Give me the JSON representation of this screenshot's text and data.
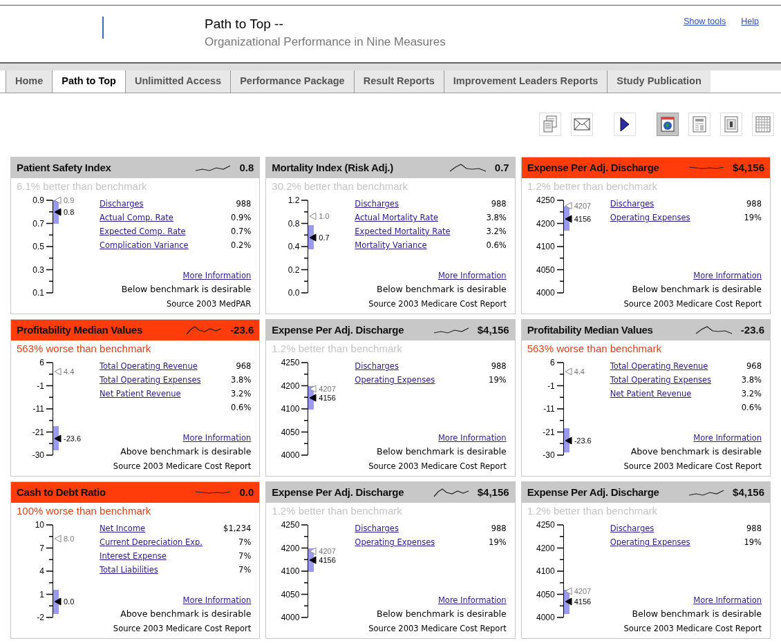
{
  "header": {
    "title": "Path to Top --",
    "subtitle": "Organizational Performance in Nine Measures",
    "links": [
      "Show tools",
      "Help"
    ]
  },
  "tabs": [
    {
      "label": "Home",
      "selected": false
    },
    {
      "label": "Path to Top",
      "selected": true
    },
    {
      "label": "Unlimitted Access",
      "selected": false
    },
    {
      "label": "Performance Package",
      "selected": false
    },
    {
      "label": "Result Reports",
      "selected": false
    },
    {
      "label": "Improvement Leaders Reports",
      "selected": false
    },
    {
      "label": "Study Publication",
      "selected": false
    }
  ],
  "toolbar": [
    {
      "selected": false
    },
    {
      "selected": false
    },
    {
      "selected": false
    },
    {
      "selected": true
    },
    {
      "selected": false
    },
    {
      "selected": false
    },
    {
      "selected": false
    }
  ],
  "cards": [
    {
      "title": "Patient Safety Index",
      "value": "0.8",
      "alert": false,
      "status": {
        "text": "6.1% better than benchmark",
        "worse": false
      },
      "scale": [
        "0.9",
        "0.7",
        "0.5",
        "0.3",
        "0.1"
      ],
      "benchmark": {
        "label": "0.9",
        "level": 1.0
      },
      "actual": {
        "label": "0.8",
        "level": 0.875
      },
      "metrics": [
        {
          "label": "Discharges",
          "value": "988"
        },
        {
          "label": "Actual Comp. Rate",
          "value": "0.9%"
        },
        {
          "label": "Expected Comp. Rate",
          "value": "0.7%"
        },
        {
          "label": "Complication Variance",
          "value": "0.2%"
        }
      ],
      "more": "More Information",
      "note": "Below benchmark is desirable",
      "source": "Source 2003 MedPAR"
    },
    {
      "title": "Mortality Index (Risk Adj.)",
      "value": "0.7",
      "alert": false,
      "status": {
        "text": "30.2% better than benchmark",
        "worse": false
      },
      "scale": [
        "1.2",
        "0.8",
        "0.4",
        "0.2",
        "0.0"
      ],
      "benchmark": {
        "label": "1.0",
        "level": 0.83
      },
      "actual": {
        "label": "0.7",
        "level": 0.6
      },
      "metrics": [
        {
          "label": "Discharges",
          "value": "988"
        },
        {
          "label": "Actual Mortality Rate",
          "value": "3.8%"
        },
        {
          "label": "Expected Mortality Rate",
          "value": "3.2%"
        },
        {
          "label": "Mortality Variance",
          "value": "0.6%"
        }
      ],
      "more": "More Information",
      "note": "Below benchmark is desirable",
      "source": "Source 2003 Medicare Cost Report"
    },
    {
      "title": "Expense Per Adj. Discharge",
      "value": "$4,156",
      "alert": true,
      "status": {
        "text": "1.2% better than benchmark",
        "worse": false
      },
      "scale": [
        "4250",
        "4200",
        "4100",
        "4050",
        "4000"
      ],
      "benchmark": {
        "label": "4207",
        "level": 0.94
      },
      "actual": {
        "label": "4156",
        "level": 0.8
      },
      "metrics": [
        {
          "label": "Discharges",
          "value": "988"
        },
        {
          "label": "Operating Expenses",
          "value": "19%"
        }
      ],
      "more": "More Information",
      "note": "Below benchmark is desirable",
      "source": "Source 2003 Medicare Cost Report"
    },
    {
      "title": "Profitability Median Values",
      "value": "-23.6",
      "alert": true,
      "status": {
        "text": "563% worse than benchmark",
        "worse": true
      },
      "scale": [
        "6",
        "-1",
        "-11",
        "-21",
        "-30"
      ],
      "benchmark": {
        "label": "4.4",
        "level": 0.9
      },
      "actual": {
        "label": "-23.6",
        "level": 0.18
      },
      "metrics": [
        {
          "label": "Total Operating Revenue",
          "value": "968"
        },
        {
          "label": "Total Operating Expenses",
          "value": "3.8%"
        },
        {
          "label": "Net Patient Revenue",
          "value": "3.2%"
        },
        {
          "value": "0.6%"
        }
      ],
      "more": "More Information",
      "note": "Above benchmark is desirable",
      "source": "Source 2003 Medicare Cost Report"
    },
    {
      "title": "Expense Per Adj. Discharge",
      "value": "$4,156",
      "alert": false,
      "status": {
        "text": "1.2% better than benchmark",
        "worse": false
      },
      "scale": [
        "4250",
        "4200",
        "4100",
        "4050",
        "4000"
      ],
      "benchmark": {
        "label": "4207",
        "level": 0.72
      },
      "actual": {
        "label": "4156",
        "level": 0.62
      },
      "metrics": [
        {
          "label": "Discharges",
          "value": "988"
        },
        {
          "label": "Operating Expenses",
          "value": "19%"
        }
      ],
      "more": "More Information",
      "note": "Below benchmark is desirable",
      "source": "Source 2003 Medicare Cost Report"
    },
    {
      "title": "Profitability Median Values",
      "value": "-23.6",
      "alert": false,
      "status": {
        "text": "563% worse than benchmark",
        "worse": true
      },
      "scale": [
        "6",
        "-1",
        "-11",
        "-21",
        "-30"
      ],
      "benchmark": {
        "label": "4.4",
        "level": 0.9
      },
      "actual": {
        "label": "-23.6",
        "level": 0.16
      },
      "metrics": [
        {
          "label": "Total Operating Revenue",
          "value": "968"
        },
        {
          "label": "Total Operating Expenses",
          "value": "3.8%"
        },
        {
          "label": "Net Patient Revenue",
          "value": "3.2%"
        },
        {
          "value": "0.6%"
        }
      ],
      "more": "More Information",
      "note": "Above benchmark is desirable",
      "source": "Source 2003 Medicare Cost Report"
    },
    {
      "title": "Cash to Debt Ratio",
      "value": "0.0",
      "alert": true,
      "status": {
        "text": "100% worse than benchmark",
        "worse": true
      },
      "scale": [
        "10",
        "7",
        "4",
        "1",
        "-2"
      ],
      "benchmark": {
        "label": "8.0",
        "level": 0.85
      },
      "actual": {
        "label": "0.0",
        "level": 0.17
      },
      "metrics": [
        {
          "label": "Net Income",
          "value": "$1,234"
        },
        {
          "label": "Current Depreciation Exp.",
          "value": "7%"
        },
        {
          "label": "Interest Expense",
          "value": "7%"
        },
        {
          "label": "Total Liabilities",
          "value": "7%"
        }
      ],
      "more": "More Information",
      "note": "Above benchmark is desirable",
      "source": "Source 2003 Medicare Cost Report"
    },
    {
      "title": "Expense Per Adj. Discharge",
      "value": "$4,156",
      "alert": false,
      "status": {
        "text": "1.2% better than benchmark",
        "worse": false
      },
      "scale": [
        "4250",
        "4200",
        "4100",
        "4050",
        "4000"
      ],
      "benchmark": {
        "label": "4207",
        "level": 0.72
      },
      "actual": {
        "label": "4156",
        "level": 0.62
      },
      "metrics": [
        {
          "label": "Discharges",
          "value": "988"
        },
        {
          "label": "Operating Expenses",
          "value": "19%"
        }
      ],
      "more": "More Information",
      "note": "Below benchmark is desirable",
      "source": "Source 2003 Medicare Cost Report"
    },
    {
      "title": "Expense Per Adj. Discharge",
      "value": "$4,156",
      "alert": false,
      "status": {
        "text": "1.2% better than benchmark",
        "worse": false
      },
      "scale": [
        "4250",
        "4200",
        "4100",
        "4050",
        "4000"
      ],
      "benchmark": {
        "label": "4207",
        "level": 0.28
      },
      "actual": {
        "label": "4156",
        "level": 0.17
      },
      "metrics": [
        {
          "label": "Discharges",
          "value": "988"
        },
        {
          "label": "Operating Expenses",
          "value": "19%"
        }
      ],
      "more": "More Information",
      "note": "Below benchmark is desirable",
      "source": "Source 2003 Medicare Cost Report"
    }
  ]
}
